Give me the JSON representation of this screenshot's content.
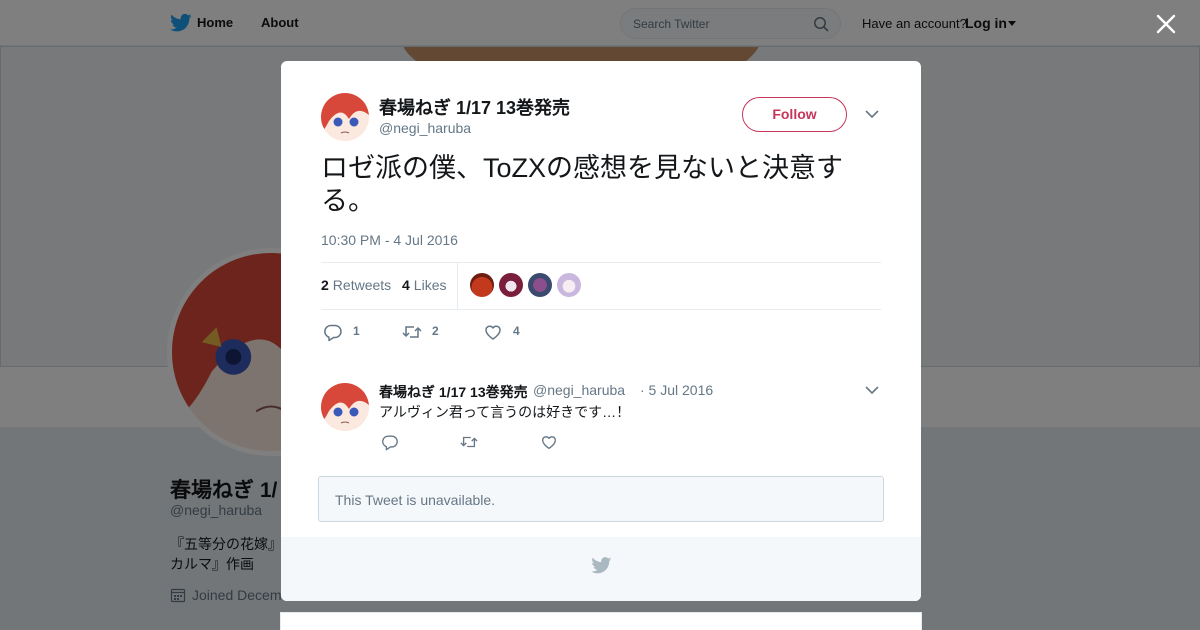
{
  "nav": {
    "home_label": "Home",
    "about_label": "About",
    "search_placeholder": "Search Twitter",
    "have_account_text": "Have an account?",
    "login_label": "Log in",
    "icons": {
      "logo": "twitter-bird-icon",
      "search": "search-icon",
      "close": "close-icon"
    }
  },
  "profile": {
    "name": "春場ねぎ 1/",
    "handle": "@negi_haruba",
    "bio_line1": "『五等分の花嫁』",
    "bio_line2": "カルマ』作画",
    "joined_text": "Joined Decem"
  },
  "tweet": {
    "author_name": "春場ねぎ 1/17 13巻発売",
    "author_handle": "@negi_haruba",
    "follow_label": "Follow",
    "text": "ロゼ派の僕、ToZXの感想を見ないと決意する。",
    "time": "10:30 PM - 4 Jul 2016",
    "retweets_count": "2",
    "retweets_label": "Retweets",
    "likes_count": "4",
    "likes_label": "Likes",
    "reply_count": "1",
    "retweet_action_count": "2",
    "like_action_count": "4"
  },
  "reply": {
    "author_name": "春場ねぎ 1/17 13巻発売",
    "author_handle": "@negi_haruba",
    "date": "· 5 Jul 2016",
    "text": "アルヴィン君って言うのは好きです…！"
  },
  "unavailable_text": "This Tweet is unavailable.",
  "colors": {
    "follow_accent": "#c5365a",
    "twitter_blue": "#1da1f2",
    "muted_text": "#657786",
    "overlay": "rgba(0,0,0,0.5)"
  }
}
